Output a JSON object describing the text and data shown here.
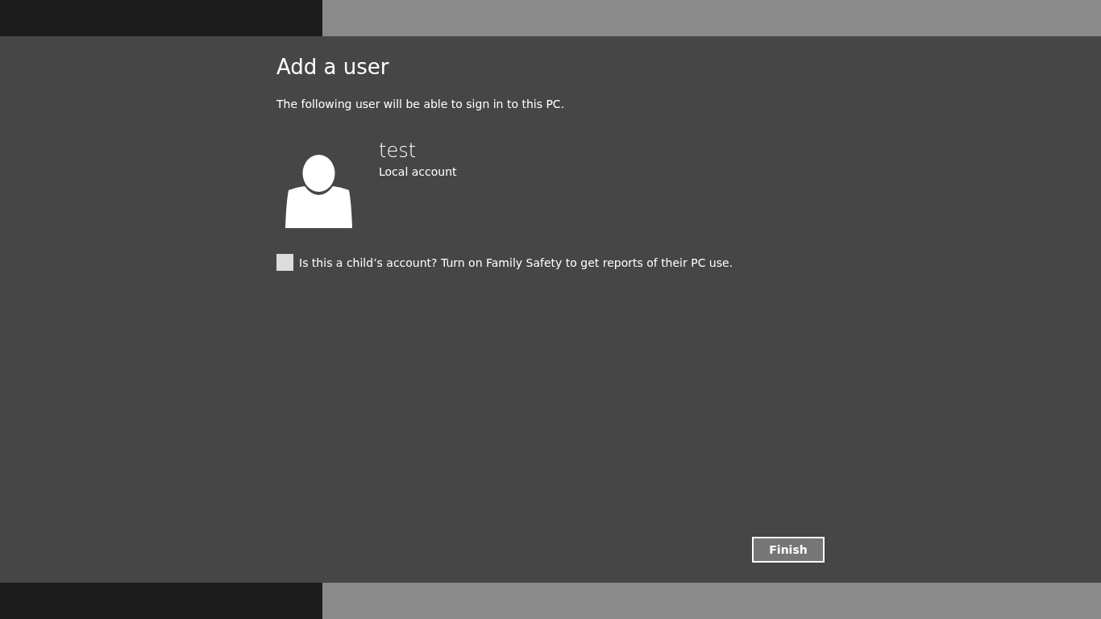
{
  "title": "Add a user",
  "subtitle": "The following user will be able to sign in to this PC.",
  "user": {
    "name": "test",
    "account_type": "Local account"
  },
  "family_safety": {
    "label": "Is this a child’s account? Turn on Family Safety to get reports of their PC use.",
    "checked": false
  },
  "finish_button": {
    "label": "Finish"
  }
}
